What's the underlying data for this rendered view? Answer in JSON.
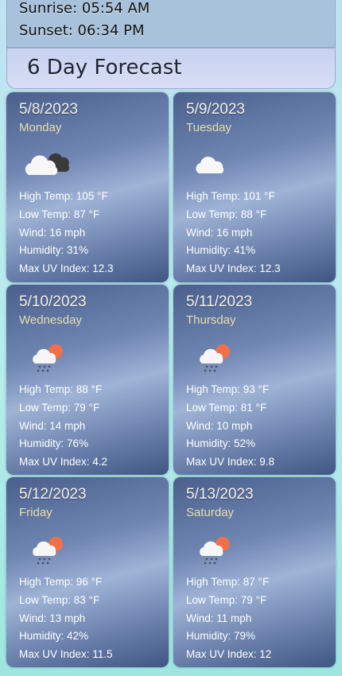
{
  "sun": {
    "sunrise": "Sunrise: 05:54 AM",
    "sunset": "Sunset: 06:34 PM"
  },
  "forecast": {
    "title": "6 Day Forecast",
    "days": [
      {
        "date": "5/8/2023",
        "day": "Monday",
        "icon": "cloudy-icon",
        "high": "High Temp: 105 °F",
        "low": "Low Temp: 87 °F",
        "wind": "Wind: 16 mph",
        "humidity": "Humidity: 31%",
        "uv": "Max UV Index: 12.3"
      },
      {
        "date": "5/9/2023",
        "day": "Tuesday",
        "icon": "cloud-icon",
        "high": "High Temp: 101 °F",
        "low": "Low Temp: 88 °F",
        "wind": "Wind: 16 mph",
        "humidity": "Humidity: 41%",
        "uv": "Max UV Index: 12.3"
      },
      {
        "date": "5/10/2023",
        "day": "Wednesday",
        "icon": "sun-rain-icon",
        "high": "High Temp: 88 °F",
        "low": "Low Temp: 79 °F",
        "wind": "Wind: 14 mph",
        "humidity": "Humidity: 76%",
        "uv": "Max UV Index: 4.2"
      },
      {
        "date": "5/11/2023",
        "day": "Thursday",
        "icon": "sun-rain-icon",
        "high": "High Temp: 93 °F",
        "low": "Low Temp: 81 °F",
        "wind": "Wind: 10 mph",
        "humidity": "Humidity: 52%",
        "uv": "Max UV Index: 9.8"
      },
      {
        "date": "5/12/2023",
        "day": "Friday",
        "icon": "sun-rain-icon",
        "high": "High Temp: 96 °F",
        "low": "Low Temp: 83 °F",
        "wind": "Wind: 13 mph",
        "humidity": "Humidity: 42%",
        "uv": "Max UV Index: 11.5"
      },
      {
        "date": "5/13/2023",
        "day": "Saturday",
        "icon": "sun-rain-icon",
        "high": "High Temp: 87 °F",
        "low": "Low Temp: 79 °F",
        "wind": "Wind: 11 mph",
        "humidity": "Humidity: 79%",
        "uv": "Max UV Index: 12"
      }
    ]
  }
}
